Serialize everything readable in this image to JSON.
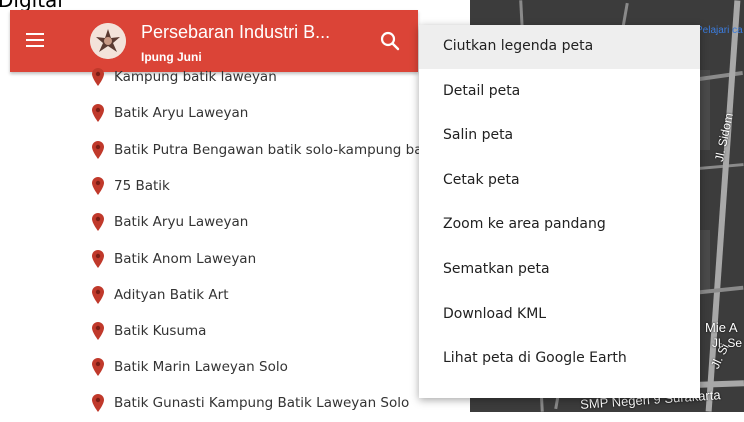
{
  "top_partial_text": "Digital",
  "header": {
    "title": "Persebaran Industri B...",
    "subtitle": "Ipung Juni",
    "menu_icon": "hamburger-icon",
    "search_icon": "search-icon",
    "color": "#db4437"
  },
  "places": [
    "Kampung batik laweyan",
    "Batik Aryu Laweyan",
    "Batik Putra Bengawan batik solo-kampung batik",
    "75 Batik",
    "Batik Aryu Laweyan",
    "Batik Anom Laweyan",
    "Adityan Batik Art",
    "Batik Kusuma",
    "Batik Marin Laweyan Solo",
    "Batik Gunasti Kampung Batik Laweyan Solo"
  ],
  "menu": {
    "items": [
      "Ciutkan legenda peta",
      "Detail peta",
      "Salin peta",
      "Cetak peta",
      "Zoom ke area pandang",
      "Sematkan peta",
      "Download KML",
      "Lihat peta di Google Earth"
    ],
    "active_index": 0
  },
  "map": {
    "top_link": "Pelajari ca",
    "labels": [
      "Jl. Sidom",
      "Jl. Si",
      "Mie A",
      "Jl. Se",
      "SMP Negeri 9 Surakarta"
    ]
  }
}
